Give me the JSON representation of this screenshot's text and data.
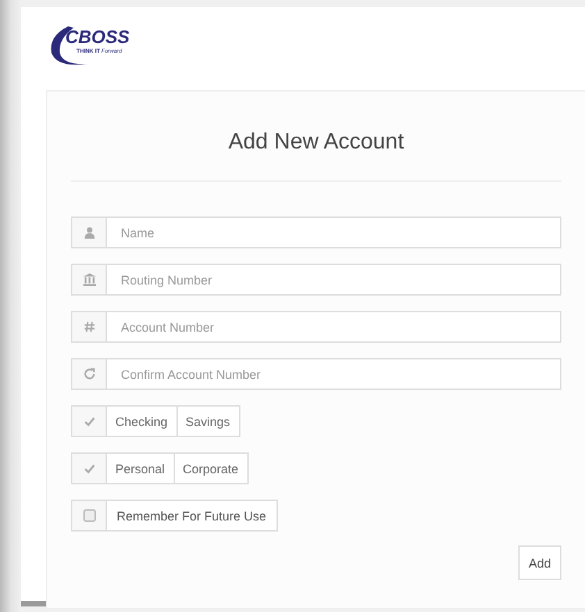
{
  "logo": {
    "name": "CBOSS",
    "tagline_bold": "THINK IT",
    "tagline": "Forward"
  },
  "form": {
    "title": "Add New Account",
    "fields": [
      {
        "kind": "name",
        "placeholder": "Name"
      },
      {
        "kind": "routing",
        "placeholder": "Routing Number"
      },
      {
        "kind": "account",
        "placeholder": "Account Number"
      },
      {
        "kind": "confirm",
        "placeholder": "Confirm Account Number"
      }
    ],
    "option_groups": [
      {
        "options": [
          "Checking",
          "Savings"
        ]
      },
      {
        "options": [
          "Personal",
          "Corporate"
        ]
      }
    ],
    "remember": {
      "label": "Remember For Future Use",
      "checked": false
    },
    "submit": "Add"
  }
}
